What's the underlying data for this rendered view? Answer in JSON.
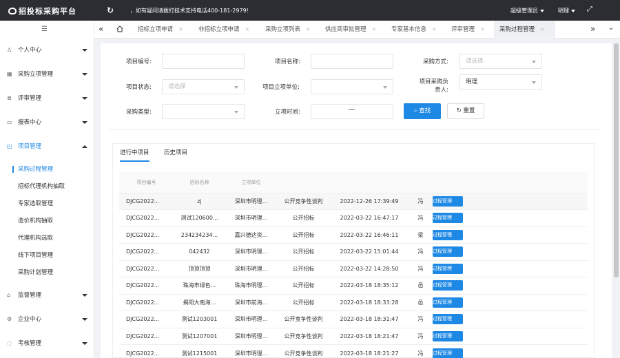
{
  "header": {
    "logo": "招投标采购平台",
    "notice": "，如有疑问请拨打技术支持电话400-181-2979!",
    "user_role": "超级管理员",
    "user_name": "明理"
  },
  "tabs": {
    "items": [
      {
        "label": "招标立项申请"
      },
      {
        "label": "非招标立项申请"
      },
      {
        "label": "采购立项列表"
      },
      {
        "label": "供应商审批管理"
      },
      {
        "label": "专家基本信息"
      },
      {
        "label": "评审管理"
      },
      {
        "label": "采购过程管理"
      }
    ]
  },
  "sidebar": {
    "items": [
      {
        "label": "个人中心"
      },
      {
        "label": "采购立项管理"
      },
      {
        "label": "评审管理"
      },
      {
        "label": "报表中心"
      },
      {
        "label": "项目管理"
      },
      {
        "label": "监督管理"
      },
      {
        "label": "企业中心"
      },
      {
        "label": "考核管理"
      }
    ],
    "sub_items": [
      {
        "label": "采购过程管理"
      },
      {
        "label": "招标代理机构抽取"
      },
      {
        "label": "专家选取管理"
      },
      {
        "label": "造价机构抽取"
      },
      {
        "label": "代理机构选取"
      },
      {
        "label": "线下项目管理"
      },
      {
        "label": "采购计划管理"
      }
    ]
  },
  "filters": {
    "project_no_label": "项目编号:",
    "project_name_label": "项目名称:",
    "purchase_method_label": "采购方式:",
    "purchase_method_placeholder": "请选择",
    "project_status_label": "项目状态:",
    "project_status_placeholder": "请选择",
    "project_unit_label": "项目立项单位:",
    "purchase_owner_label": "项目采购负责人:",
    "purchase_owner_value": "明理",
    "purchase_type_label": "采购类型:",
    "setup_time_label": "立项时间:",
    "date_separator": "一",
    "search_label": "查找",
    "reset_label": "重置"
  },
  "panel": {
    "tabs": [
      {
        "label": "进行中项目"
      },
      {
        "label": "历史项目"
      }
    ]
  },
  "table": {
    "headers": [
      "项目编号",
      "招标名称",
      "立项单位",
      "",
      "",
      "",
      ""
    ],
    "rows": [
      {
        "no": "DJCG2022...",
        "name": "zj",
        "unit": "深圳市明理...",
        "method": "公开竞争性谈判",
        "time": "2022-12-26 17:39:49",
        "person": "冯",
        "action": "过程管理"
      },
      {
        "no": "DJCG2022...",
        "name": "测试120600...",
        "unit": "深圳市明理...",
        "method": "公开招标",
        "time": "2022-03-22 16:47:17",
        "person": "冯",
        "action": "过程管理"
      },
      {
        "no": "DJCG2022...",
        "name": "234234234...",
        "unit": "嘉兴德达资...",
        "method": "公开招标",
        "time": "2022-03-22 16:46:11",
        "person": "梁",
        "action": "过程管理"
      },
      {
        "no": "DJCG2022...",
        "name": "042432",
        "unit": "深圳市明理...",
        "method": "公开招标",
        "time": "2022-03-22 15:01:44",
        "person": "冯",
        "action": "过程管理"
      },
      {
        "no": "DJCG2022...",
        "name": "顶顶顶顶",
        "unit": "深圳市明理...",
        "method": "公开招标",
        "time": "2022-03-22 14:28:50",
        "person": "冯",
        "action": "过程管理"
      },
      {
        "no": "DJCG2022...",
        "name": "珠海市绿色...",
        "unit": "珠海市明理...",
        "method": "公开招标",
        "time": "2022-03-18 18:35:12",
        "person": "邑",
        "action": "过程管理"
      },
      {
        "no": "DJCG2022...",
        "name": "揭阳大南海...",
        "unit": "深圳市前海...",
        "method": "公开招标",
        "time": "2022-03-18 18:33:28",
        "person": "邑",
        "action": "过程管理"
      },
      {
        "no": "DJCG2022...",
        "name": "测试1203001",
        "unit": "深圳市明理...",
        "method": "公开竞争性谈判",
        "time": "2022-03-18 18:31:47",
        "person": "冯",
        "action": "过程管理"
      },
      {
        "no": "DJCG2022...",
        "name": "测试1207001",
        "unit": "深圳市明理...",
        "method": "公开竞争性谈判",
        "time": "2022-03-18 18:21:47",
        "person": "冯",
        "action": "过程管理"
      },
      {
        "no": "DJCG2022...",
        "name": "测试1215001",
        "unit": "深圳市明理...",
        "method": "公开竞争性谈判",
        "time": "2022-03-18 18:21:27",
        "person": "冯",
        "action": "过程管理"
      }
    ]
  }
}
